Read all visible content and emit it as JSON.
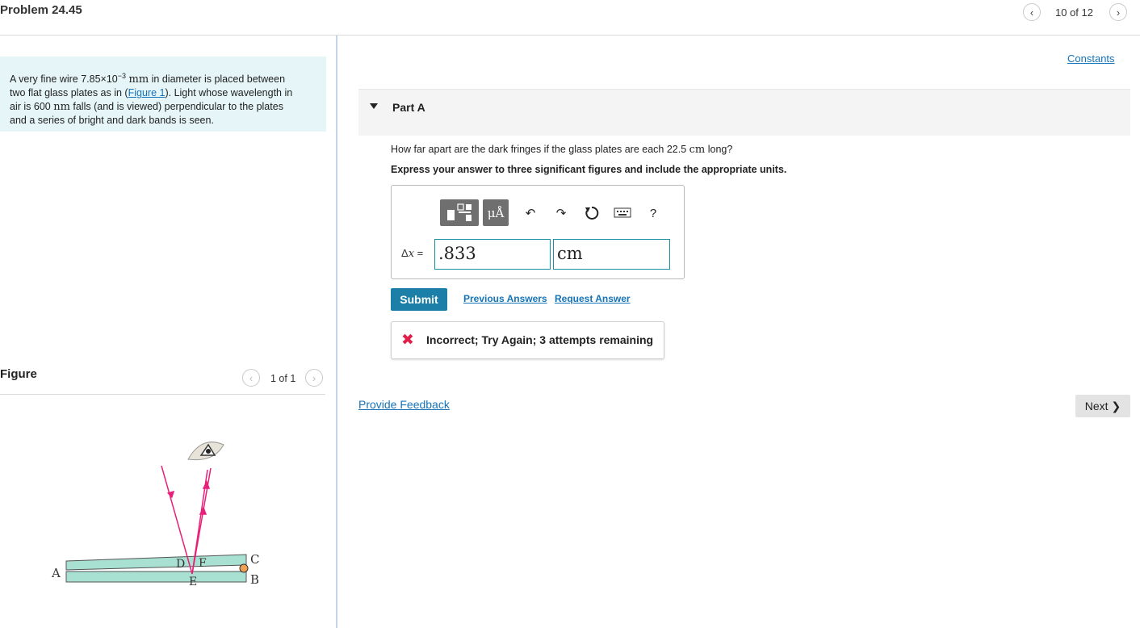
{
  "header": {
    "problem_title": "Problem 24.45",
    "pager_text": "10 of 12"
  },
  "statement": {
    "t1": "A very fine wire 7.85×10",
    "exp": "−3",
    "unit_mm": "mm",
    "t2": " in diameter is placed between",
    "t3": "two flat glass plates as in (",
    "figure_link": "Figure 1",
    "t4": "). Light whose wavelength in",
    "t5": "air is 600 ",
    "unit_nm": "nm",
    "t6": " falls (and is viewed) perpendicular to the plates",
    "t7": "and a series of bright and dark bands is seen."
  },
  "figure": {
    "title": "Figure",
    "counter": "1 of 1",
    "labels": {
      "a": "A",
      "b": "B",
      "c": "C",
      "d": "D",
      "e": "E",
      "f": "F"
    }
  },
  "constants_link": "Constants",
  "part_a": {
    "label": "Part A",
    "question_pre": "How far apart are the dark fringes if the glass plates are each 22.5 ",
    "question_unit": "cm",
    "question_post": " long?",
    "instruction": "Express your answer to three significant figures and include the appropriate units.",
    "toolbar": {
      "units_label": "μÅ",
      "help_label": "?"
    },
    "answer_label_delta": "Δ",
    "answer_label_var": "x",
    "answer_label_eq": " =",
    "answer_value": ".833",
    "answer_unit": "cm",
    "submit_label": "Submit",
    "previous_answers_label": "Previous Answers",
    "request_answer_label": "Request Answer",
    "feedback_icon": "✖",
    "feedback_text": "Incorrect; Try Again; 3 attempts remaining"
  },
  "provide_feedback_label": "Provide Feedback",
  "next_label": "Next",
  "colors": {
    "accent": "#1c7fa8",
    "statement_bg": "#e5f5f8",
    "error": "#e0204a",
    "glass": "#a8e0d2",
    "ray": "#e8207a"
  }
}
